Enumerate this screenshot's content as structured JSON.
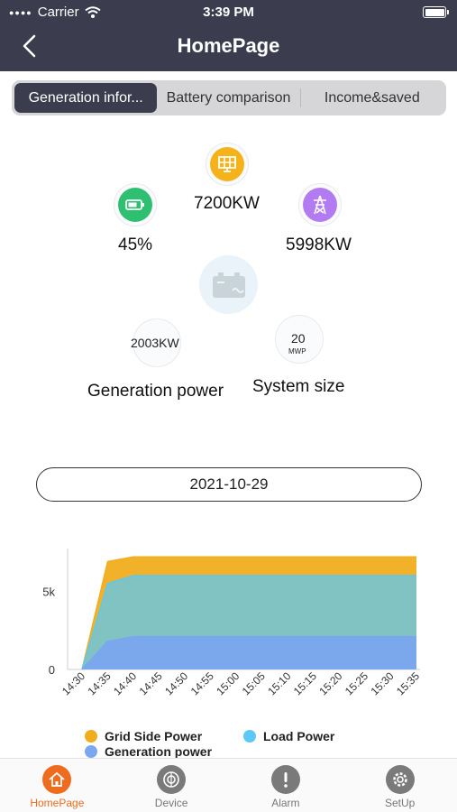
{
  "status_bar": {
    "carrier": "Carrier",
    "time": "3:39 PM"
  },
  "header": {
    "title": "HomePage"
  },
  "tabs": [
    {
      "label": "Generation infor...",
      "active": true
    },
    {
      "label": "Battery comparison",
      "active": false
    },
    {
      "label": "Income&saved",
      "active": false
    }
  ],
  "overview": {
    "battery": {
      "icon": "battery-icon",
      "value": "45%",
      "color": "#2fbf71"
    },
    "solar": {
      "icon": "solar-panel-icon",
      "value": "7200KW",
      "color": "#f5b21b"
    },
    "grid": {
      "icon": "power-tower-icon",
      "value": "5998KW",
      "color": "#b37bf2"
    },
    "center": {
      "icon": "inverter-icon"
    },
    "generation_power": {
      "value": "2003KW",
      "label": "Generation power"
    },
    "system_size": {
      "value": "20",
      "unit": "MWP",
      "label": "System size"
    }
  },
  "date": "2021-10-29",
  "chart_data": {
    "type": "area",
    "x": [
      "14:30",
      "14:35",
      "14:40",
      "14:45",
      "14:50",
      "14:55",
      "15:00",
      "15:05",
      "15:10",
      "15:15",
      "15:20",
      "15:25",
      "15:30",
      "15:35"
    ],
    "ylim": [
      0,
      7500
    ],
    "yticks": [
      {
        "value": 0,
        "label": "0"
      },
      {
        "value": 5000,
        "label": "5k"
      }
    ],
    "series": [
      {
        "name": "Grid Side Power",
        "color": "#f0ad1d",
        "values": [
          0,
          6900,
          7200,
          7200,
          7200,
          7200,
          7200,
          7200,
          7200,
          7200,
          7200,
          7200,
          7200,
          7200
        ]
      },
      {
        "name": "Load Power",
        "color": "#5bc8f5",
        "values": [
          0,
          5500,
          6000,
          6000,
          6000,
          6000,
          6000,
          6000,
          6000,
          6000,
          6000,
          6000,
          6000,
          6000
        ]
      },
      {
        "name": "Generation power",
        "color": "#7aa7ee",
        "values": [
          0,
          1800,
          2100,
          2100,
          2100,
          2100,
          2100,
          2100,
          2100,
          2100,
          2100,
          2100,
          2100,
          2100
        ]
      }
    ]
  },
  "tabbar": [
    {
      "label": "HomePage",
      "icon": "home-icon",
      "active": true
    },
    {
      "label": "Device",
      "icon": "device-icon",
      "active": false
    },
    {
      "label": "Alarm",
      "icon": "alarm-icon",
      "active": false
    },
    {
      "label": "SetUp",
      "icon": "gear-icon",
      "active": false
    }
  ]
}
